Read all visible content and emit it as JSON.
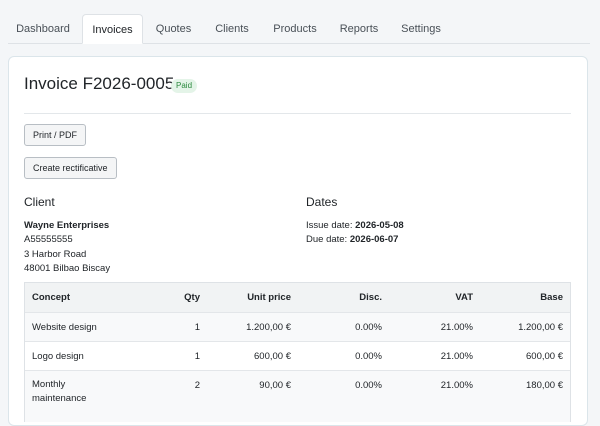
{
  "nav": {
    "tabs": [
      {
        "label": "Dashboard"
      },
      {
        "label": "Invoices",
        "active": true
      },
      {
        "label": "Quotes"
      },
      {
        "label": "Clients"
      },
      {
        "label": "Products"
      },
      {
        "label": "Reports"
      },
      {
        "label": "Settings"
      }
    ]
  },
  "invoice": {
    "title": "Invoice F2026-0005",
    "status": "Paid"
  },
  "actions": {
    "print_label": "Print / PDF",
    "rectify_label": "Create rectificative"
  },
  "client": {
    "heading": "Client",
    "name": "Wayne Enterprises",
    "tax_id": "A55555555",
    "address": "3 Harbor Road",
    "city": "48001 Bilbao Biscay"
  },
  "dates": {
    "heading": "Dates",
    "issue_label": "Issue date:",
    "issue_value": "2026-05-08",
    "due_label": "Due date:",
    "due_value": "2026-06-07"
  },
  "table": {
    "headers": {
      "concept": "Concept",
      "qty": "Qty",
      "unit_price": "Unit price",
      "disc": "Disc.",
      "vat": "VAT",
      "base": "Base"
    },
    "rows": [
      {
        "concept": "Website design",
        "qty": "1",
        "unit_price": "1.200,00 €",
        "disc": "0.00%",
        "vat": "21.00%",
        "base": "1.200,00 €"
      },
      {
        "concept": "Logo design",
        "qty": "1",
        "unit_price": "600,00 €",
        "disc": "0.00%",
        "vat": "21.00%",
        "base": "600,00 €"
      },
      {
        "concept": "Monthly maintenance",
        "qty": "2",
        "unit_price": "90,00 €",
        "disc": "0.00%",
        "vat": "21.00%",
        "base": "180,00 €"
      }
    ]
  },
  "colors": {
    "paid_badge_bg": "#e4f4e8",
    "paid_badge_text": "#2b8a3e"
  }
}
